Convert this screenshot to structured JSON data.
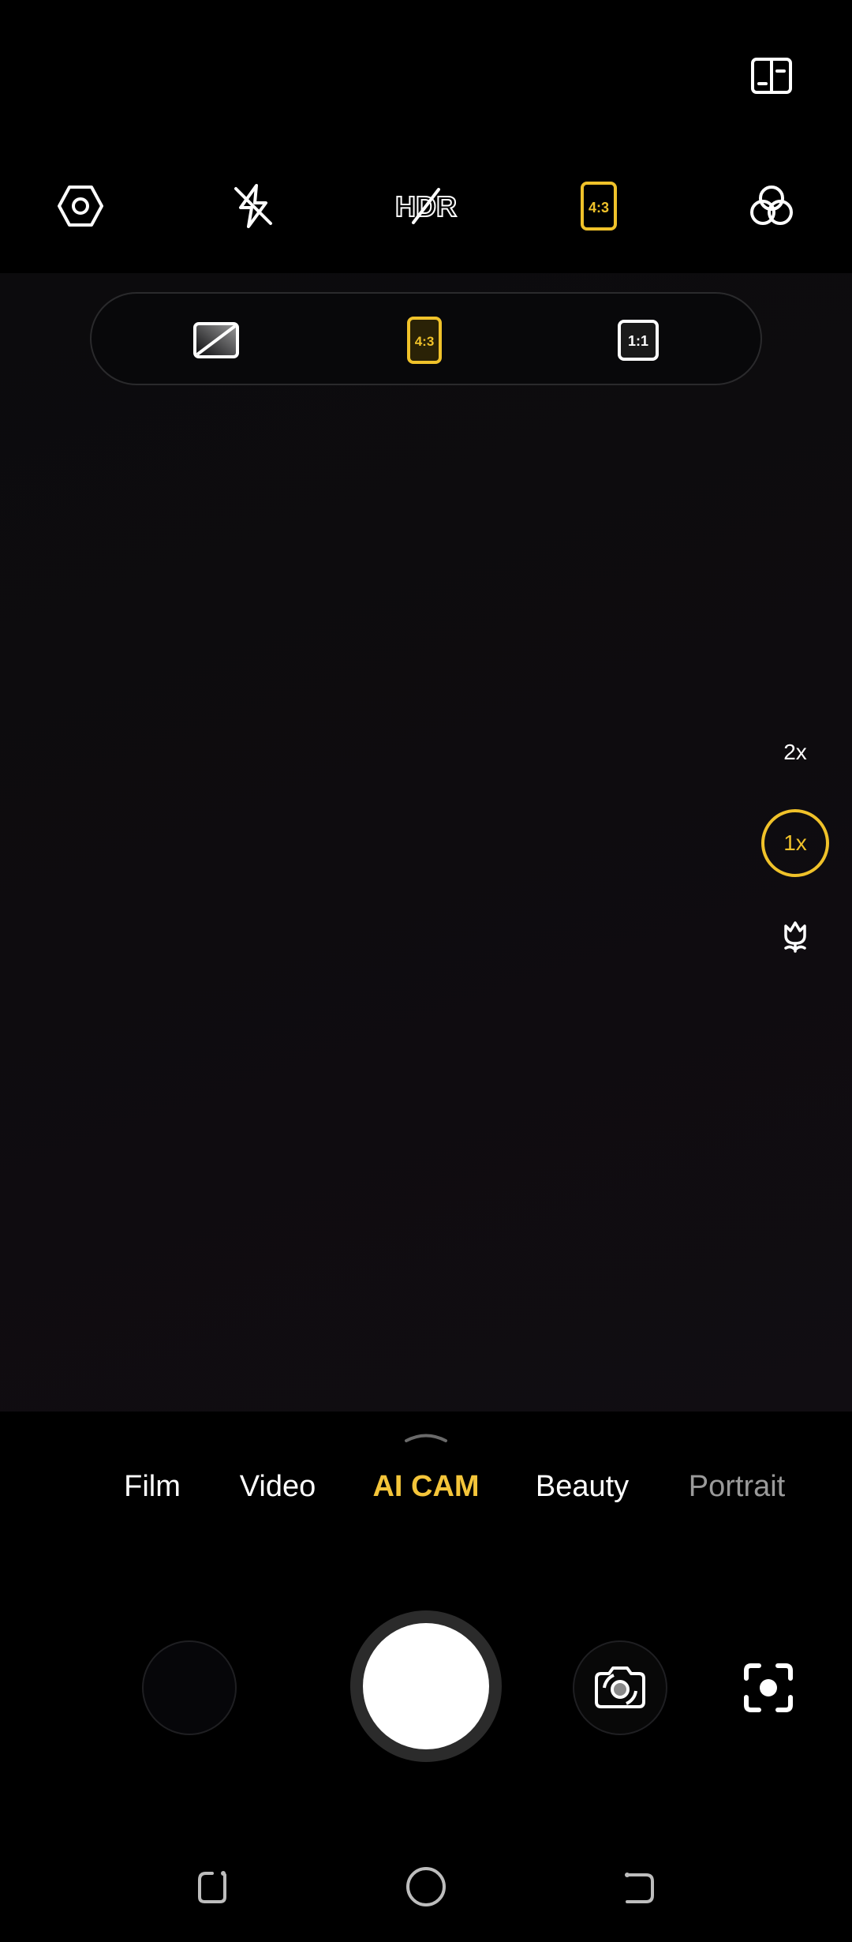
{
  "top_bar": {
    "guide_icon": "book-icon",
    "tools": [
      {
        "id": "settings",
        "icon": "hexagon-settings-icon"
      },
      {
        "id": "flash",
        "icon": "flash-off-icon"
      },
      {
        "id": "hdr",
        "icon": "hdr-icon",
        "label": "HDR"
      },
      {
        "id": "ratio",
        "icon": "aspect-ratio-icon",
        "label": "4:3",
        "active": true
      },
      {
        "id": "filters",
        "icon": "filters-icon"
      }
    ]
  },
  "ratio_selector": {
    "options": [
      {
        "id": "full",
        "icon": "fullscreen-ratio-icon"
      },
      {
        "id": "4_3",
        "label": "4:3",
        "active": true
      },
      {
        "id": "1_1",
        "label": "1:1"
      }
    ]
  },
  "zoom": {
    "levels": [
      {
        "label": "2x"
      },
      {
        "label": "1x",
        "active": true
      },
      {
        "label": "macro",
        "icon": "macro-flower-icon"
      }
    ]
  },
  "modes": {
    "items": [
      "Film",
      "Video",
      "AI CAM",
      "Beauty",
      "Portrait"
    ],
    "active": "AI CAM"
  },
  "colors": {
    "accent": "#f4c53a",
    "background": "#000000",
    "viewfinder": "#0e0c0f"
  }
}
